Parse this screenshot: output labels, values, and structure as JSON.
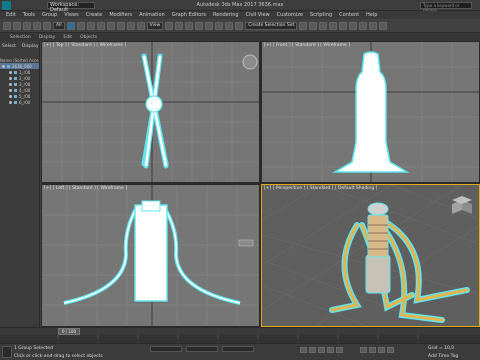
{
  "titlebar": {
    "workspace": "Workspace: Default",
    "title": "Autodesk 3ds Max 2017       3636.max",
    "search_placeholder": "Type a keyword or phrase"
  },
  "menu": [
    "Edit",
    "Tools",
    "Group",
    "Views",
    "Create",
    "Modifiers",
    "Animation",
    "Graph Editors",
    "Rendering",
    "Civil View",
    "Customize",
    "Scripting",
    "Content",
    "Help"
  ],
  "toolbar": {
    "filter": "All",
    "view": "View",
    "selection_set": "Create Selection Set"
  },
  "ribbon": [
    "Selection",
    "Display",
    "Edit",
    "Objects"
  ],
  "scene_explorer": {
    "tabs": [
      "Select",
      "Display"
    ],
    "header": "Name (Sorted Ascending)",
    "items": [
      {
        "name": "3636_000",
        "selected": true,
        "group": true
      },
      {
        "name": "1_r00",
        "selected": false,
        "group": false
      },
      {
        "name": "2_r00",
        "selected": false,
        "group": false
      },
      {
        "name": "3_r00",
        "selected": false,
        "group": false
      },
      {
        "name": "4_r00",
        "selected": false,
        "group": false
      },
      {
        "name": "5_r00",
        "selected": false,
        "group": false
      },
      {
        "name": "6_r00",
        "selected": false,
        "group": false
      }
    ]
  },
  "viewports": {
    "top": "[+] [ Top ] [ Standard ] [ Wireframe ]",
    "front": "[+] [ Front ] [ Standard ] [ Wireframe ]",
    "left": "[+] [ Left ] [ Standard ] [ Wireframe ]",
    "perspective": "[+] [ Perspective ] [ Standard ] [ Default Shading ]"
  },
  "timeline": {
    "slider": "0 / 100"
  },
  "status": {
    "selection": "1 Group Selected",
    "prompt": "Click or click-and-drag to select objects",
    "grid": "Grid = 10,0",
    "add_time_tag": "Add Time Tag"
  },
  "colors": {
    "accent": "#e1ad16",
    "wire_cyan": "#5fe6f0",
    "viewport_bg": "#767676"
  }
}
